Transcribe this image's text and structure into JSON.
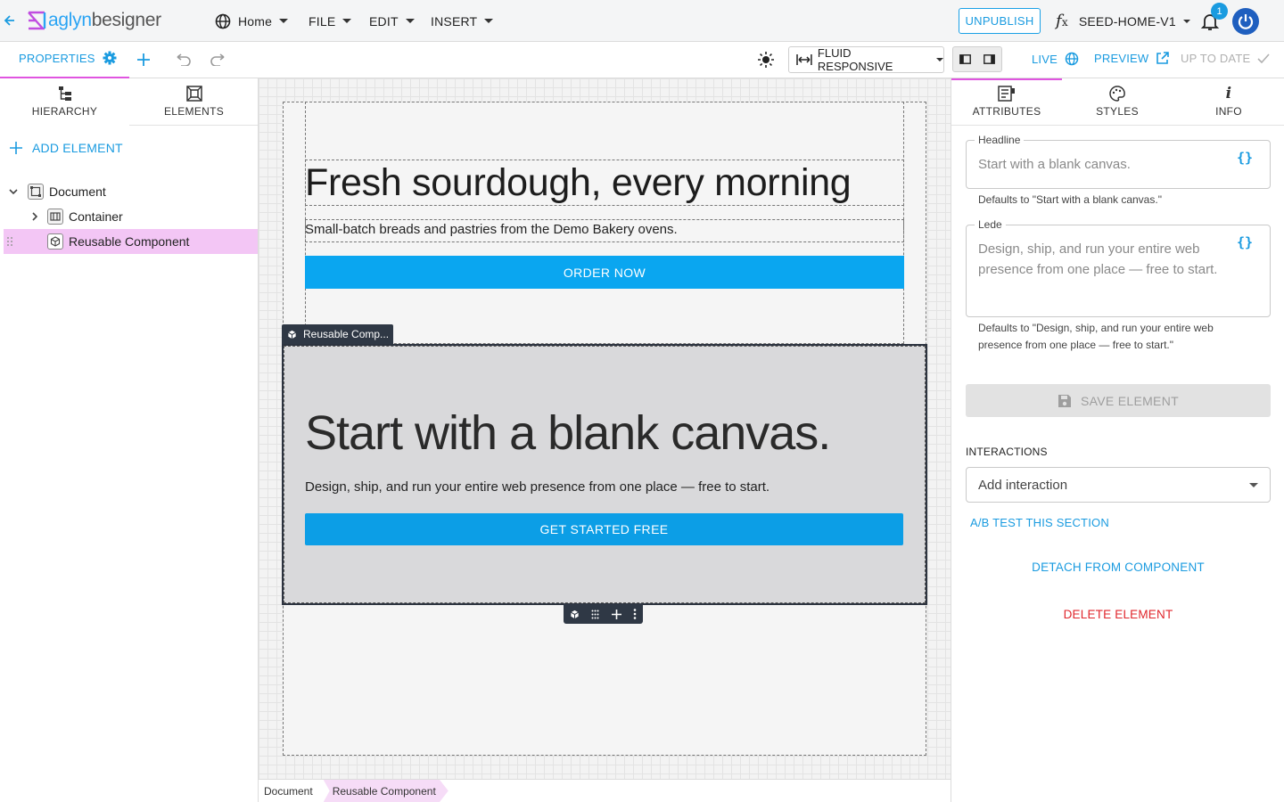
{
  "app": {
    "logo_a": "aglyn",
    "logo_b": "besigner"
  },
  "topbar": {
    "menus": [
      "Home",
      "FILE",
      "EDIT",
      "INSERT"
    ],
    "unpublish_label": "UNPUBLISH",
    "project_name": "SEED-HOME-V1",
    "notification_count": "1"
  },
  "toolbar": {
    "properties_label": "PROPERTIES",
    "fluid_label": "FLUID RESPONSIVE",
    "live_label": "LIVE",
    "preview_label": "PREVIEW",
    "status_label": "UP TO DATE"
  },
  "left_panel": {
    "tabs": [
      "HIERARCHY",
      "ELEMENTS"
    ],
    "add_element_label": "ADD ELEMENT",
    "tree": [
      {
        "label": "Document"
      },
      {
        "label": "Container"
      },
      {
        "label": "Reusable Component"
      }
    ]
  },
  "canvas": {
    "hero_title": "Fresh sourdough, every morning",
    "hero_sub": "Small-batch breads and pastries from the Demo Bakery ovens.",
    "hero_cta": "ORDER NOW",
    "component_tag": "Reusable Comp...",
    "component_title": "Start with a blank canvas.",
    "component_sub": "Design, ship, and run your entire web presence from one place — free to start.",
    "component_cta": "GET STARTED FREE",
    "breadcrumb": [
      "Document",
      "Reusable Component"
    ]
  },
  "right_panel": {
    "tabs": [
      "ATTRIBUTES",
      "STYLES",
      "INFO"
    ],
    "headline_label": "Headline",
    "headline_placeholder": "Start with a blank canvas.",
    "headline_helper": "Defaults to \"Start with a blank canvas.\"",
    "lede_label": "Lede",
    "lede_placeholder": "Design, ship, and run your entire web presence from one place — free to start.",
    "lede_helper": "Defaults to \"Design, ship, and run your entire web presence from one place — free to start.\"",
    "save_label": "SAVE ELEMENT",
    "interactions_label": "INTERACTIONS",
    "interaction_placeholder": "Add interaction",
    "ab_test_label": "A/B TEST THIS SECTION",
    "detach_label": "DETACH FROM COMPONENT",
    "delete_label": "DELETE ELEMENT"
  },
  "colors": {
    "accent": "#1a9be0",
    "selection": "#f3c6f5",
    "danger": "#e0262c",
    "cta": "#0aa6f0"
  },
  "icons": [
    "back-arrow-icon",
    "globe-icon",
    "function-icon",
    "bell-icon",
    "power-icon",
    "gear-icon",
    "plus-icon",
    "undo-icon",
    "redo-icon",
    "sun-icon",
    "width-icon",
    "external-link-icon",
    "check-icon",
    "hierarchy-icon",
    "elements-icon",
    "attributes-icon",
    "palette-icon",
    "info-icon",
    "save-icon",
    "cube-icon",
    "drag-handle-icon",
    "more-icon"
  ]
}
